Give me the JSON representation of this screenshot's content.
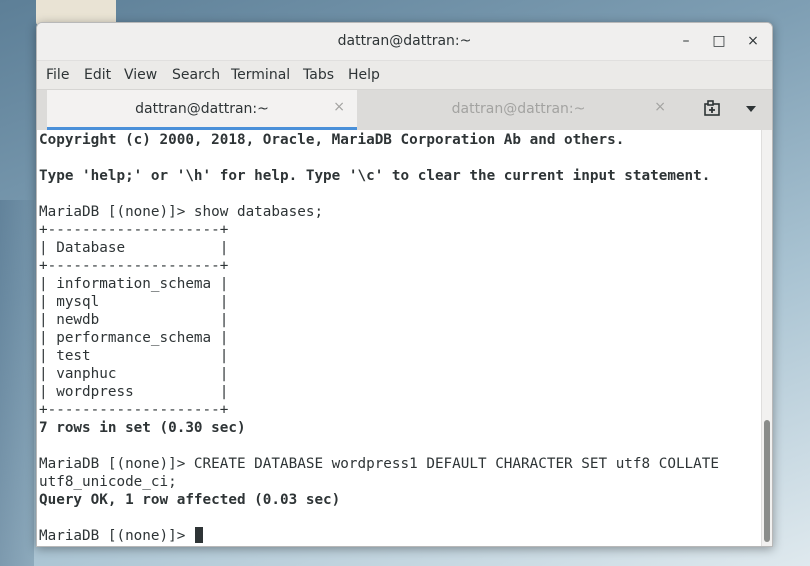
{
  "window": {
    "title": "dattran@dattran:~",
    "minimize": "–",
    "maximize": "□",
    "close": "×"
  },
  "menu": [
    "File",
    "Edit",
    "View",
    "Search",
    "Terminal",
    "Tabs",
    "Help"
  ],
  "tabs": [
    {
      "label": "dattran@dattran:~",
      "active": true,
      "close": "×"
    },
    {
      "label": "dattran@dattran:~",
      "active": false,
      "close": "×"
    }
  ],
  "terminal": {
    "lines": [
      "Copyright (c) 2000, 2018, Oracle, MariaDB Corporation Ab and others.",
      "",
      "Type 'help;' or '\\h' for help. Type '\\c' to clear the current input statement.",
      "",
      "MariaDB [(none)]> show databases;",
      "+--------------------+",
      "| Database           |",
      "+--------------------+",
      "| information_schema |",
      "| mysql              |",
      "| newdb              |",
      "| performance_schema |",
      "| test               |",
      "| vanphuc            |",
      "| wordpress          |",
      "+--------------------+",
      "7 rows in set (0.30 sec)",
      "",
      "MariaDB [(none)]> CREATE DATABASE wordpress1 DEFAULT CHARACTER SET utf8 COLLATE",
      "utf8_unicode_ci;",
      "Query OK, 1 row affected (0.03 sec)",
      "",
      "MariaDB [(none)]> "
    ]
  }
}
